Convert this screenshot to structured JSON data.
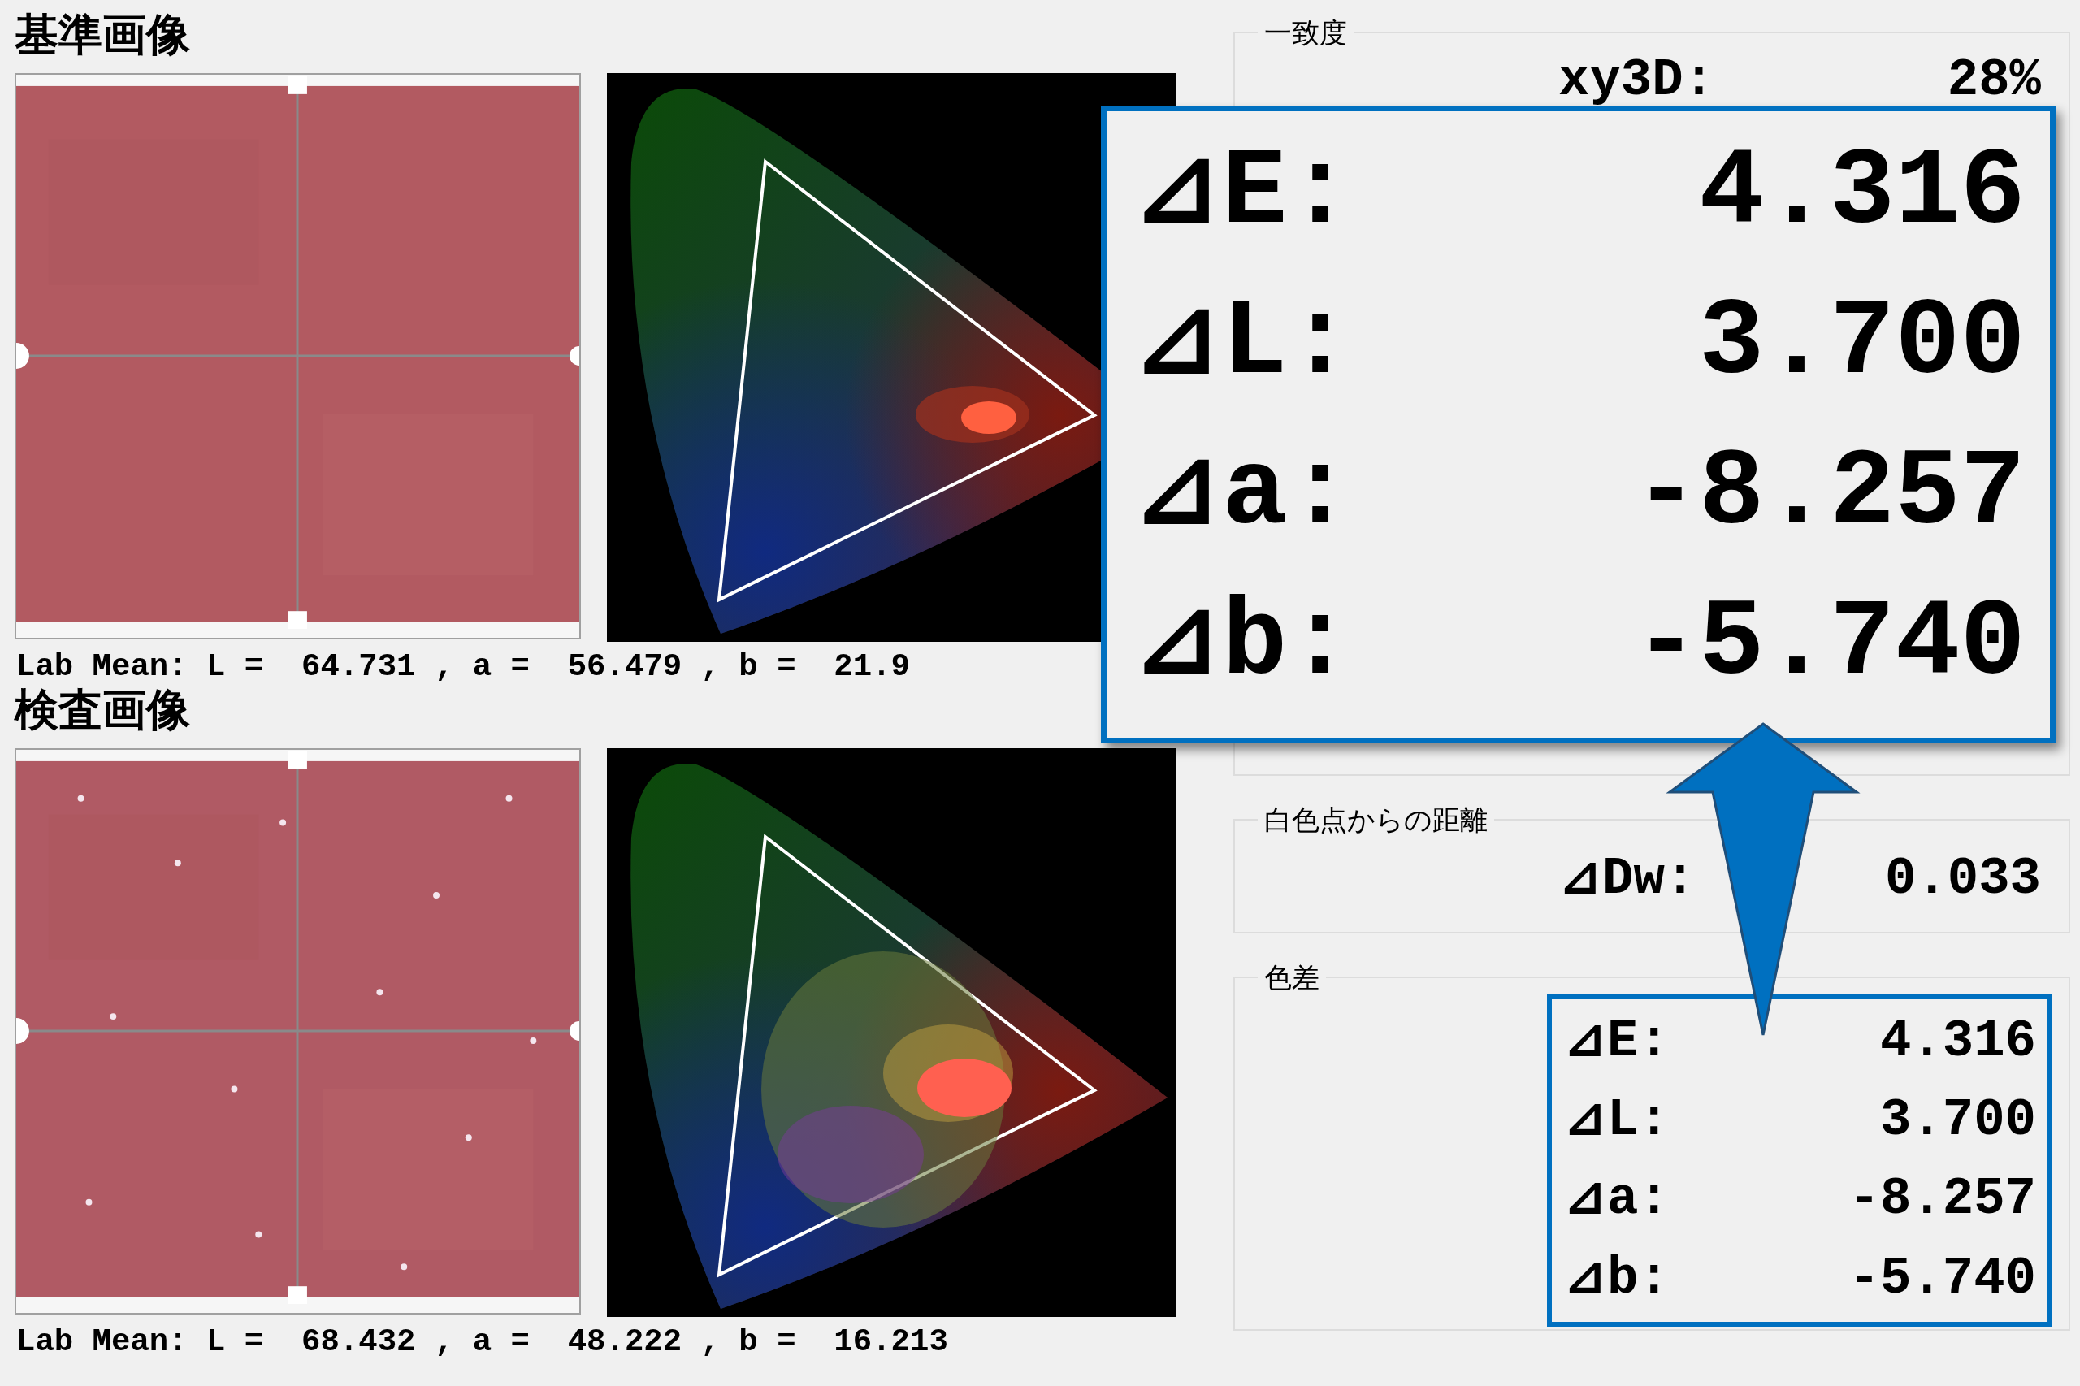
{
  "panels": [
    {
      "title": "基準画像",
      "lab_mean": "Lab Mean: L =  64.731 , a =  56.479 , b =  21.9"
    },
    {
      "title": "検査画像",
      "lab_mean": "Lab Mean: L =  68.432 , a =  48.222 , b =  16.213"
    }
  ],
  "groups": [
    {
      "title": "一致度",
      "highlighted": false,
      "rows": [
        {
          "label": "xy3D:",
          "value": "28%"
        }
      ]
    },
    {
      "title": "白色点からの距離",
      "highlighted": false,
      "rows": [
        {
          "label": "⊿Dw:",
          "value": "0.033"
        }
      ]
    },
    {
      "title": "色差",
      "highlighted": true,
      "rows": [
        {
          "label": "⊿E:",
          "value": "4.316"
        },
        {
          "label": "⊿L:",
          "value": "3.700"
        },
        {
          "label": "⊿a:",
          "value": "-8.257"
        },
        {
          "label": "⊿b:",
          "value": "-5.740"
        }
      ]
    }
  ],
  "callout": {
    "rows": [
      {
        "label": "⊿E:",
        "value": "4.316"
      },
      {
        "label": "⊿L:",
        "value": "3.700"
      },
      {
        "label": "⊿a:",
        "value": "-8.257"
      },
      {
        "label": "⊿b:",
        "value": "-5.740"
      }
    ]
  }
}
